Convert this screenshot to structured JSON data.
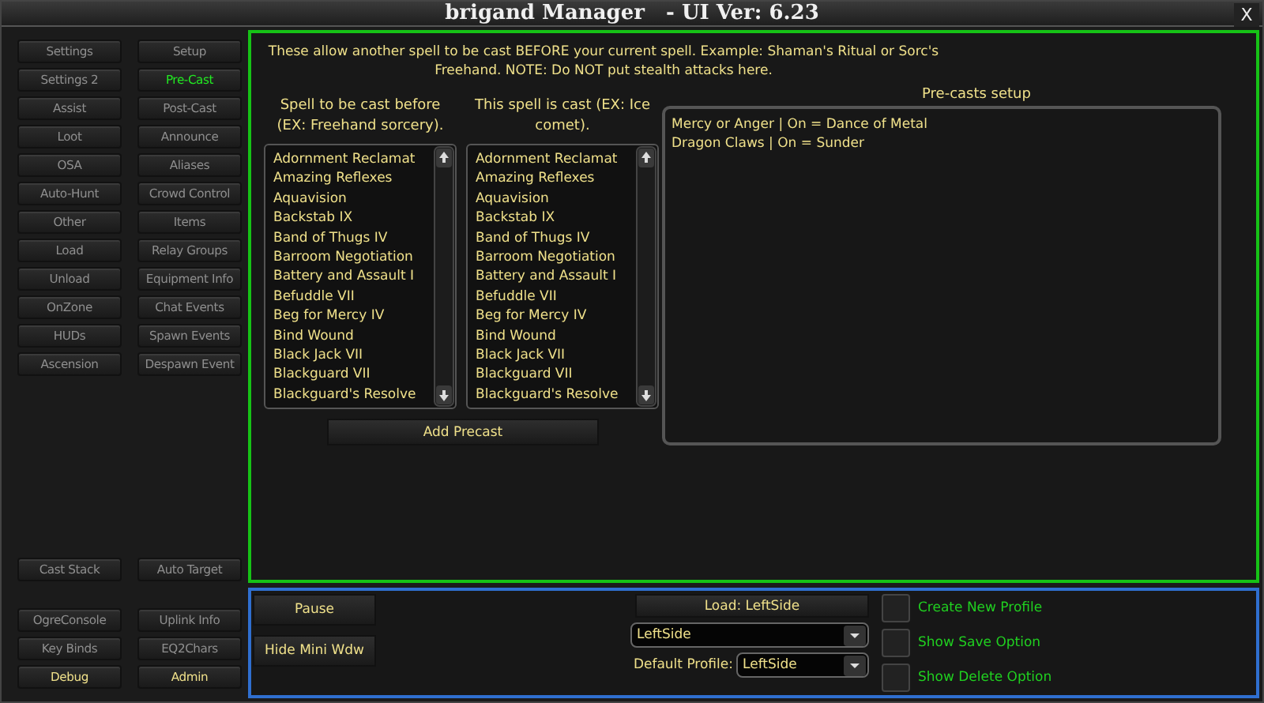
{
  "window": {
    "title": "brigand Manager   - UI Ver: 6.23",
    "close": "X"
  },
  "sidebar": {
    "top": [
      {
        "label": "Settings",
        "selected": false,
        "kind": "normal"
      },
      {
        "label": "Setup",
        "selected": false,
        "kind": "normal"
      },
      {
        "label": "Settings 2",
        "selected": false,
        "kind": "normal"
      },
      {
        "label": "Pre-Cast",
        "selected": true,
        "kind": "normal"
      },
      {
        "label": "Assist",
        "selected": false,
        "kind": "normal"
      },
      {
        "label": "Post-Cast",
        "selected": false,
        "kind": "normal"
      },
      {
        "label": "Loot",
        "selected": false,
        "kind": "normal"
      },
      {
        "label": "Announce",
        "selected": false,
        "kind": "normal"
      },
      {
        "label": "OSA",
        "selected": false,
        "kind": "normal"
      },
      {
        "label": "Aliases",
        "selected": false,
        "kind": "normal"
      },
      {
        "label": "Auto-Hunt",
        "selected": false,
        "kind": "normal"
      },
      {
        "label": "Crowd Control",
        "selected": false,
        "kind": "normal"
      },
      {
        "label": "Other",
        "selected": false,
        "kind": "normal"
      },
      {
        "label": "Items",
        "selected": false,
        "kind": "normal"
      },
      {
        "label": "Load",
        "selected": false,
        "kind": "normal"
      },
      {
        "label": "Relay Groups",
        "selected": false,
        "kind": "normal"
      },
      {
        "label": "Unload",
        "selected": false,
        "kind": "normal"
      },
      {
        "label": "Equipment Info",
        "selected": false,
        "kind": "normal"
      },
      {
        "label": "OnZone",
        "selected": false,
        "kind": "normal"
      },
      {
        "label": "Chat Events",
        "selected": false,
        "kind": "normal"
      },
      {
        "label": "HUDs",
        "selected": false,
        "kind": "normal"
      },
      {
        "label": "Spawn Events",
        "selected": false,
        "kind": "normal"
      },
      {
        "label": "Ascension",
        "selected": false,
        "kind": "normal"
      },
      {
        "label": "Despawn Event",
        "selected": false,
        "kind": "normal"
      }
    ],
    "middle": [
      {
        "label": "Cast Stack",
        "selected": false,
        "kind": "normal"
      },
      {
        "label": "Auto Target",
        "selected": false,
        "kind": "normal"
      }
    ],
    "bottom": [
      {
        "label": "OgreConsole",
        "selected": false,
        "kind": "normal"
      },
      {
        "label": "Uplink Info",
        "selected": false,
        "kind": "normal"
      },
      {
        "label": "Key Binds",
        "selected": false,
        "kind": "normal"
      },
      {
        "label": "EQ2Chars",
        "selected": false,
        "kind": "normal"
      },
      {
        "label": "Debug",
        "selected": false,
        "kind": "accent"
      },
      {
        "label": "Admin",
        "selected": false,
        "kind": "accent"
      }
    ]
  },
  "main": {
    "description": "These allow another spell to be cast BEFORE your current spell. Example: Shaman's Ritual or Sorc's Freehand. NOTE: Do NOT put stealth attacks here.",
    "lists": [
      {
        "heading": "Spell to be cast before (EX: Freehand sorcery).",
        "items": [
          "Adornment Reclamat",
          "Amazing Reflexes",
          "Aquavision",
          "Backstab IX",
          "Band of Thugs IV",
          "Barroom Negotiation",
          "Battery and Assault I",
          "Befuddle VII",
          "Beg for Mercy IV",
          "Bind Wound",
          "Black Jack VII",
          "Blackguard VII",
          "Blackguard's Resolve"
        ]
      },
      {
        "heading": "This spell is cast (EX: Ice comet).",
        "items": [
          "Adornment Reclamat",
          "Amazing Reflexes",
          "Aquavision",
          "Backstab IX",
          "Band of Thugs IV",
          "Barroom Negotiation",
          "Battery and Assault I",
          "Befuddle VII",
          "Beg for Mercy IV",
          "Bind Wound",
          "Black Jack VII",
          "Blackguard VII",
          "Blackguard's Resolve"
        ]
      }
    ],
    "add_button": "Add Precast",
    "setup": {
      "heading": "Pre-casts setup",
      "entries": [
        "Mercy or Anger | On = Dance of Metal",
        "Dragon Claws | On = Sunder"
      ]
    }
  },
  "footer": {
    "buttons": [
      "Pause",
      "Hide Mini Wdw"
    ],
    "load_button": "Load: LeftSide",
    "profile": {
      "value": "LeftSide"
    },
    "default_profile": {
      "label": "Default Profile:",
      "value": "LeftSide"
    },
    "options": [
      {
        "label": "Create New Profile",
        "checked": false
      },
      {
        "label": "Show Save Option",
        "checked": false
      },
      {
        "label": "Show Delete Option",
        "checked": false
      }
    ]
  }
}
